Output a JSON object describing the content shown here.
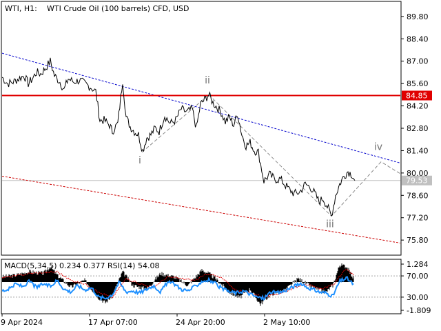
{
  "header": {
    "symbol": "WTI, H1:",
    "description": "WTI Crude Oil (100 barrels) CFD, USD"
  },
  "indicator_header": "MACD(5,34,5) 0.234 0.377 RSI(14) 54.08",
  "colors": {
    "price_line": "#000000",
    "resistance_line": "#e00000",
    "upper_trend": "#0000cc",
    "lower_trend": "#cc0000",
    "wave_path": "#888888",
    "bid_line": "#c0c0c0",
    "macd_hist": "#000000",
    "macd_signal": "#e00000",
    "rsi_line": "#1e90ff",
    "current_price_label_bg": "#c0c0c0",
    "level_label_bg": "#e00000"
  },
  "chart_data": [
    {
      "type": "line",
      "title": "WTI Crude Oil (100 barrels) CFD, USD",
      "timeframe": "H1",
      "y_ticks": [
        "89.80",
        "88.40",
        "87.00",
        "85.60",
        "84.20",
        "82.80",
        "81.40",
        "80.00",
        "78.60",
        "77.20",
        "75.80"
      ],
      "ylim": [
        74.9,
        90.7
      ],
      "x_ticks": [
        "9 Apr 2024",
        "17 Apr 07:00",
        "24 Apr 20:00",
        "2 May 10:00"
      ],
      "current_price": "79.53",
      "horizontal_levels": [
        {
          "value": "84.85"
        }
      ],
      "wave_labels": [
        "i",
        "ii",
        "iii",
        "iv"
      ],
      "trend_lines": [
        {
          "name": "upper",
          "points": [
            [
              0,
              87.5
            ],
            [
              580,
              80.6
            ]
          ]
        },
        {
          "name": "lower",
          "points": [
            [
              0,
              79.8
            ],
            [
              580,
              75.6
            ]
          ]
        }
      ],
      "wave_path": [
        [
          203,
          81.3
        ],
        [
          300,
          84.9
        ],
        [
          478,
          77.3
        ],
        [
          550,
          80.7
        ],
        [
          580,
          79.9
        ]
      ],
      "series": [
        {
          "x": [
            0,
            8,
            16,
            24,
            32,
            38,
            44,
            50,
            56,
            62,
            70,
            76,
            84,
            90,
            96,
            104,
            112,
            120,
            128,
            136,
            142,
            148,
            156,
            160,
            168,
            175,
            180,
            186,
            192,
            198,
            204,
            210,
            216,
            222,
            228,
            236,
            244,
            252,
            260,
            268,
            276,
            282,
            288,
            294,
            300,
            306,
            312,
            318,
            324,
            330,
            336,
            342,
            348,
            354,
            360,
            366,
            372,
            380,
            388,
            396,
            404,
            410,
            416,
            424,
            432,
            440,
            448,
            454,
            460,
            466,
            472,
            478,
            484,
            490,
            496,
            502,
            508,
            512
          ],
          "values": [
            86.0,
            85.6,
            85.7,
            85.9,
            86.1,
            85.6,
            85.9,
            86.3,
            86.2,
            86.5,
            87.0,
            86.1,
            85.7,
            85.2,
            85.9,
            85.7,
            85.8,
            85.6,
            85.4,
            85.1,
            83.3,
            83.3,
            83.0,
            82.6,
            83.1,
            85.8,
            83.5,
            82.9,
            82.6,
            82.4,
            81.4,
            82.2,
            82.4,
            82.8,
            82.6,
            83.6,
            83.1,
            83.3,
            84.0,
            83.8,
            84.0,
            82.8,
            84.3,
            84.6,
            84.9,
            84.4,
            84.1,
            83.8,
            83.2,
            83.5,
            83.0,
            83.7,
            82.4,
            81.7,
            81.9,
            81.4,
            81.3,
            79.5,
            79.9,
            79.6,
            79.6,
            79.3,
            79.0,
            78.7,
            78.8,
            79.3,
            79.1,
            78.7,
            78.2,
            78.4,
            77.9,
            77.3,
            78.6,
            79.3,
            79.8,
            80.1,
            79.9,
            79.53
          ]
        }
      ]
    },
    {
      "type": "line",
      "title": "MACD(5,34,5) 0.234 0.377 RSI(14) 54.08",
      "y_ticks": [
        "1.284",
        "70.00",
        "30.00",
        "-1.809"
      ],
      "ylim": [
        -1.809,
        1.284
      ],
      "x_ticks": [
        "9 Apr 2024",
        "17 Apr 07:00",
        "24 Apr 20:00",
        "2 May 10:00"
      ],
      "series": [
        {
          "name": "MACD",
          "x": [
            0,
            20,
            40,
            60,
            70,
            80,
            100,
            120,
            140,
            150,
            160,
            175,
            190,
            210,
            230,
            250,
            270,
            290,
            300,
            310,
            330,
            345,
            360,
            375,
            390,
            410,
            430,
            450,
            470,
            480,
            490,
            500,
            510
          ],
          "values": [
            0.3,
            0.4,
            0.6,
            0.5,
            0.9,
            0.4,
            -0.3,
            0.1,
            -0.9,
            -1.2,
            -0.8,
            0.6,
            -0.2,
            -0.4,
            0.5,
            0.3,
            -0.2,
            0.7,
            0.5,
            0.2,
            -0.6,
            -0.9,
            -0.4,
            -1.3,
            -0.7,
            -0.5,
            0.2,
            -0.3,
            -0.6,
            -0.2,
            1.0,
            0.9,
            0.234
          ]
        },
        {
          "name": "Signal",
          "x": [
            0,
            20,
            40,
            60,
            80,
            100,
            120,
            140,
            160,
            180,
            200,
            220,
            240,
            260,
            280,
            300,
            320,
            340,
            360,
            380,
            400,
            420,
            440,
            460,
            480,
            500,
            510
          ],
          "values": [
            0.25,
            0.35,
            0.5,
            0.55,
            0.6,
            0.1,
            -0.1,
            -0.6,
            -0.9,
            0.2,
            -0.1,
            -0.3,
            0.3,
            0.2,
            0.1,
            0.5,
            0.2,
            -0.5,
            -0.6,
            -0.9,
            -0.7,
            -0.4,
            -0.1,
            -0.4,
            -0.2,
            0.8,
            0.377
          ]
        },
        {
          "name": "RSI",
          "x": [
            0,
            10,
            20,
            30,
            40,
            50,
            60,
            70,
            80,
            90,
            100,
            110,
            120,
            130,
            140,
            150,
            160,
            170,
            180,
            190,
            200,
            210,
            220,
            230,
            240,
            250,
            260,
            270,
            280,
            290,
            300,
            310,
            320,
            330,
            340,
            350,
            360,
            370,
            380,
            390,
            400,
            410,
            420,
            430,
            440,
            450,
            460,
            470,
            480,
            490,
            500,
            510
          ],
          "values": [
            42,
            45,
            55,
            50,
            60,
            48,
            55,
            50,
            62,
            45,
            40,
            52,
            44,
            48,
            30,
            28,
            35,
            58,
            40,
            42,
            38,
            45,
            52,
            40,
            58,
            55,
            45,
            42,
            50,
            60,
            62,
            55,
            45,
            40,
            38,
            42,
            36,
            30,
            28,
            40,
            38,
            42,
            48,
            55,
            50,
            45,
            40,
            38,
            32,
            60,
            66,
            54.08
          ]
        }
      ]
    }
  ]
}
